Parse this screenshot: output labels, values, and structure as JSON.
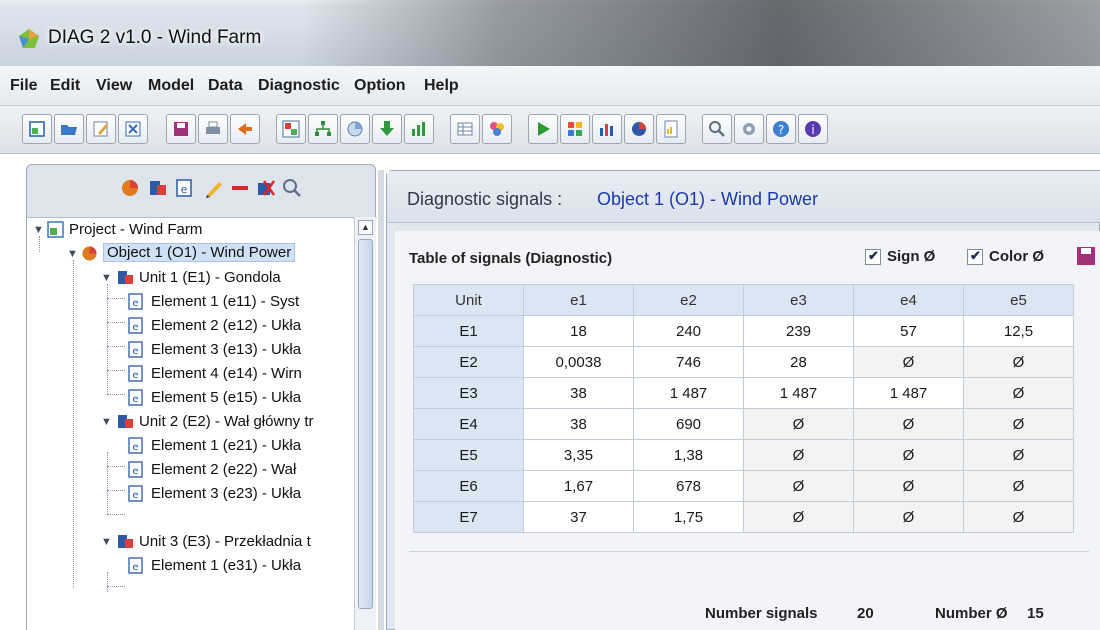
{
  "window": {
    "title": "DIAG 2  v1.0 - Wind Farm"
  },
  "menu": [
    "File",
    "Edit",
    "View",
    "Model",
    "Data",
    "Diagnostic",
    "Option",
    "Help"
  ],
  "toolbar": {
    "icons": [
      "new-project-icon",
      "open-folder-icon",
      "edit-icon",
      "close-document-icon",
      "save-icon",
      "print-icon",
      "exit-icon",
      "model-icon",
      "hierarchy-icon",
      "chart-view-icon",
      "download-icon",
      "bars-icon",
      "table-icon",
      "palette-icon",
      "run-icon",
      "grid-icon",
      "bar-chart-icon",
      "pie-chart-icon",
      "report-icon",
      "zoom-icon",
      "settings-icon",
      "help-icon",
      "info-icon"
    ]
  },
  "left_tools": {
    "icons": [
      "add-object-icon",
      "add-unit-icon",
      "add-element-icon",
      "edit-pencil-icon",
      "remove-icon",
      "delete-tool-icon",
      "search-icon"
    ]
  },
  "tree": [
    {
      "level": 0,
      "icon": "project-icon",
      "label": "Project - Wind Farm",
      "toggle": "expanded"
    },
    {
      "level": 1,
      "icon": "object-icon",
      "label": "Object 1 (O1) - Wind Power",
      "toggle": "expanded",
      "selected": true
    },
    {
      "level": 2,
      "icon": "unit-icon",
      "label": "Unit 1 (E1) - Gondola",
      "toggle": "expanded"
    },
    {
      "level": 3,
      "icon": "element-icon",
      "label": "Element 1 (e11) - Syst"
    },
    {
      "level": 3,
      "icon": "element-icon",
      "label": "Element 2 (e12) - Ukła"
    },
    {
      "level": 3,
      "icon": "element-icon",
      "label": "Element 3 (e13) - Ukła"
    },
    {
      "level": 3,
      "icon": "element-icon",
      "label": "Element 4 (e14) - Wirn"
    },
    {
      "level": 3,
      "icon": "element-icon",
      "label": "Element 5 (e15) - Ukła"
    },
    {
      "level": 2,
      "icon": "unit-icon",
      "label": "Unit 2 (E2) - Wał główny tr",
      "toggle": "expanded"
    },
    {
      "level": 3,
      "icon": "element-icon",
      "label": "Element 1 (e21) - Ukła"
    },
    {
      "level": 3,
      "icon": "element-icon",
      "label": "Element 2 (e22) - Wał"
    },
    {
      "level": 3,
      "icon": "element-icon",
      "label": "Element 3 (e23) - Ukła"
    },
    {
      "level": 2,
      "icon": "unit-icon",
      "label": "Unit 3 (E3) - Przekładnia t",
      "toggle": "expanded"
    },
    {
      "level": 3,
      "icon": "element-icon",
      "label": "Element 1 (e31) - Ukła"
    }
  ],
  "diagnostic": {
    "header_label": "Diagnostic signals :",
    "object_label": "Object 1 (O1) - Wind Power",
    "table_caption": "Table of signals (Diagnostic)",
    "sign_label": "Sign Ø",
    "color_label": "Color Ø",
    "columns": [
      "Unit",
      "e1",
      "e2",
      "e3",
      "e4",
      "e5"
    ],
    "rows": [
      [
        "E1",
        "18",
        "240",
        "239",
        "57",
        "12,5"
      ],
      [
        "E2",
        "0,0038",
        "746",
        "28",
        "Ø",
        "Ø"
      ],
      [
        "E3",
        "38",
        "1 487",
        "1 487",
        "1 487",
        "Ø"
      ],
      [
        "E4",
        "38",
        "690",
        "Ø",
        "Ø",
        "Ø"
      ],
      [
        "E5",
        "3,35",
        "1,38",
        "Ø",
        "Ø",
        "Ø"
      ],
      [
        "E6",
        "1,67",
        "678",
        "Ø",
        "Ø",
        "Ø"
      ],
      [
        "E7",
        "37",
        "1,75",
        "Ø",
        "Ø",
        "Ø"
      ]
    ],
    "number_signals_label": "Number signals",
    "number_signals_value": "20",
    "number_empty_label": "Number Ø",
    "number_empty_value": "15"
  }
}
